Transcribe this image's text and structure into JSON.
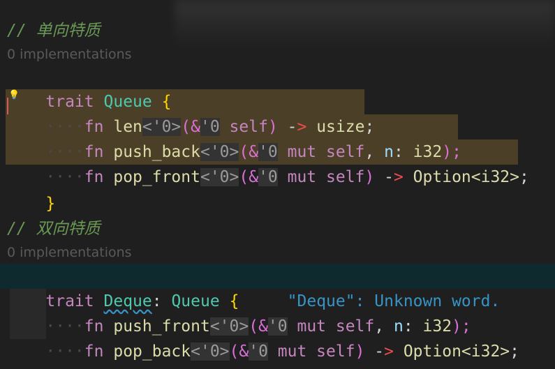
{
  "editor": {
    "block1": {
      "comment": "// 单向特质",
      "codelens": "0 implementations",
      "decl": {
        "kw": "trait",
        "name": "Queue",
        "open": "{"
      },
      "methods": [
        {
          "fn": "fn",
          "name": "len",
          "lt": "<'0>",
          "lp": "(&",
          "ltref": "'0",
          "self": " self",
          "rp": ")",
          "arrow_dash": " -",
          "arrow_head": ">",
          "ret": " usize",
          "end": ";"
        },
        {
          "fn": "fn",
          "name": "push_back",
          "lt": "<'0>",
          "lp": "(&",
          "ltref": "'0",
          "mut": " mut",
          "self": " self",
          "comma": ", ",
          "param": "n",
          "colon": ": ",
          "ptype": "i32",
          "rp": ");"
        },
        {
          "fn": "fn",
          "name": "pop_front",
          "lt": "<'0>",
          "lp": "(&",
          "ltref": "'0",
          "mut": " mut",
          "self": " self",
          "rp": ")",
          "arrow_dash": " -",
          "arrow_head": ">",
          "ret": " Option<i32>",
          "end": ";"
        }
      ],
      "close": "}"
    },
    "block2": {
      "comment": "// 双向特质",
      "codelens": "0 implementations",
      "decl": {
        "kw": "trait",
        "name": "Deque",
        "colon": ": ",
        "super": "Queue",
        "open": "{"
      },
      "diagnostic": "\"Deque\": Unknown word.",
      "methods": [
        {
          "fn": "fn",
          "name": "push_front",
          "lt": "<'0>",
          "lp": "(&",
          "ltref": "'0",
          "mut": " mut",
          "self": " self",
          "comma": ", ",
          "param": "n",
          "colon": ": ",
          "ptype": "i32",
          "rp": ");"
        },
        {
          "fn": "fn",
          "name": "pop_back",
          "lt": "<'0>",
          "lp": "(&",
          "ltref": "'0",
          "mut": " mut",
          "self": " self",
          "rp": ")",
          "arrow_dash": " -",
          "arrow_head": ">",
          "ret": " Option<i32>",
          "end": ";"
        }
      ],
      "close": "}"
    },
    "indent_dots": "····",
    "colors": {
      "background": "#1f1f1f",
      "keyword": "#c586c0",
      "function": "#dcdcaa",
      "type": "#4ec9b0",
      "comment": "#6a9955",
      "brace": "#ffd700",
      "hint": "#3794c6",
      "selection": "#be963c"
    },
    "icons": {
      "lightbulb": "lightbulb-icon"
    }
  }
}
